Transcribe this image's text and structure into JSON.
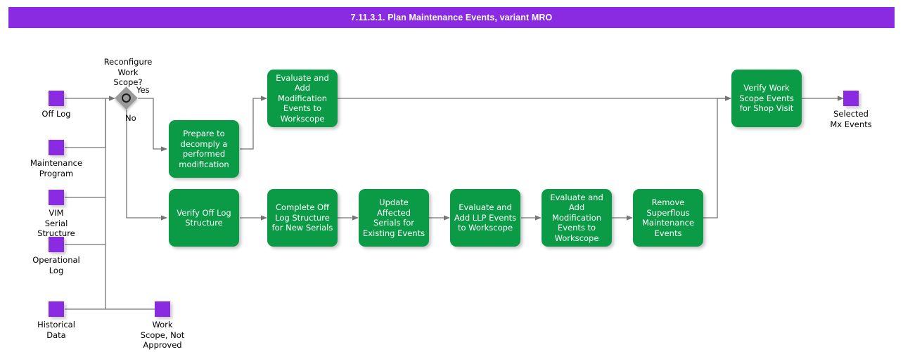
{
  "title": "7.11.3.1. Plan Maintenance Events, variant MRO",
  "colors": {
    "title_bar": "#8A2BE2",
    "data_node": "#8A2BE2",
    "process": "#0B9B46",
    "gateway": "#9A9A9A",
    "edge": "#757575",
    "text": "#000000",
    "process_text": "#FFFFFF"
  },
  "inputs": [
    {
      "label": "Off Log"
    },
    {
      "label": "Maintenance\nProgram"
    },
    {
      "label": "VIM\nSerial\nStructure"
    },
    {
      "label": "Operational\nLog"
    },
    {
      "label": "Historical\nData"
    }
  ],
  "outputs": [
    {
      "label": "Selected\nMx Events"
    },
    {
      "label": "Work\nScope, Not\nApproved"
    }
  ],
  "gateway": {
    "question": "Reconfigure\nWork\nScope?",
    "yes_label": "Yes",
    "no_label": "No"
  },
  "processes": {
    "evaluate_add_mod_top": "Evaluate and\nAdd Modification\nEvents to\nWorkscope",
    "prepare_decomply": "Prepare to\ndecomply a\nperformed\nmodification",
    "verify_work_scope": "Verify Work\nScope Events\nfor Shop Visit",
    "verify_off_log": "Verify Off Log\nStructure",
    "complete_off_log": "Complete Off\nLog Structure\nfor New Serials",
    "update_affected": "Update\nAffected Serials\nfor Existing\nEvents",
    "evaluate_llp": "Evaluate and\nAdd LLP Events\nto Workscope",
    "evaluate_add_mod_bottom": "Evaluate and\nAdd Modification\nEvents to\nWorkscope",
    "remove_superflous": "Remove\nSuperflous\nMaintenance\nEvents"
  }
}
